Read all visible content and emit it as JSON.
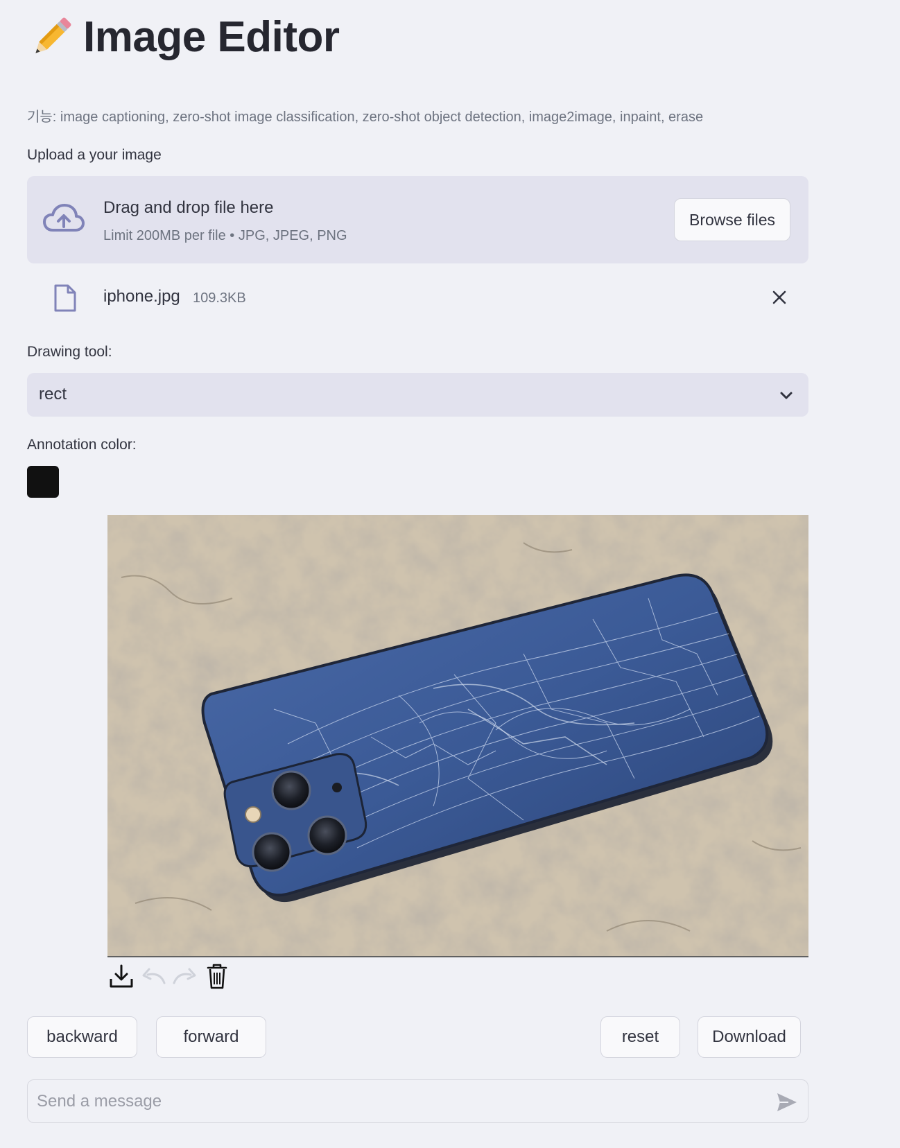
{
  "header": {
    "title": "Image Editor",
    "icon": "pencil-icon",
    "caption": "기능: image captioning, zero-shot image classification, zero-shot object detection, image2image, inpaint, erase"
  },
  "uploader": {
    "label": "Upload a your image",
    "drop_text": "Drag and drop file here",
    "limit_text": "Limit 200MB per file • JPG, JPEG, PNG",
    "browse_label": "Browse files",
    "file": {
      "name": "iphone.jpg",
      "size": "109.3KB"
    }
  },
  "drawing_tool": {
    "label": "Drawing tool:",
    "value": "rect"
  },
  "annotation_color": {
    "label": "Annotation color:",
    "value": "#111111"
  },
  "canvas": {
    "image": "photo of iPhone with shattered blue glass back on concrete floor",
    "toolbar": [
      "download-icon",
      "undo-icon",
      "redo-icon",
      "trash-icon"
    ]
  },
  "actions": {
    "backward": "backward",
    "forward": "forward",
    "reset": "reset",
    "download": "Download"
  },
  "chat": {
    "placeholder": "Send a message"
  },
  "colors": {
    "background": "#f0f1f6",
    "widget": "#e2e2ee",
    "text": "#31333f",
    "accent_icon": "#8083b8"
  }
}
